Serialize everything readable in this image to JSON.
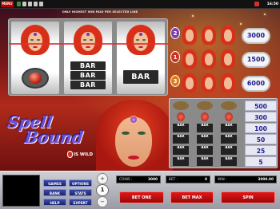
{
  "topbar": {
    "menu_label": "MENU",
    "clock": "16:50",
    "icon_colors": [
      "#3c8c3c",
      "#c8c8c8",
      "#c8c8c8",
      "#c8c8c8",
      "#c8c8c8"
    ]
  },
  "game": {
    "notice": "ONLY HIGHEST WIN PAID PER SELECTED LINE",
    "logo_line1": "Spell",
    "logo_line2": "Bound",
    "wild_label": "IS WILD",
    "reels": [
      {
        "top": "face",
        "middle": "orb"
      },
      {
        "top": "face",
        "middle": "triple-bar"
      },
      {
        "top": "face",
        "middle": "single-bar"
      }
    ],
    "bar_label": "BAR",
    "jackpots": [
      {
        "line": "2",
        "amount": "3000"
      },
      {
        "line": "1",
        "amount": "1500"
      },
      {
        "line": "3",
        "amount": "6000"
      }
    ],
    "paytable": [
      {
        "symbol": "owl",
        "pay": "500"
      },
      {
        "symbol": "orb",
        "pay": "300"
      },
      {
        "symbol": "triple-bar",
        "pay": "100"
      },
      {
        "symbol": "double-bar",
        "pay": "50"
      },
      {
        "symbol": "single-bar",
        "pay": "25"
      },
      {
        "symbol": "any-bar",
        "pay": "5"
      }
    ]
  },
  "console": {
    "games": "GAMES",
    "options": "OPTIONS",
    "bank": "BANK",
    "stats": "STATS",
    "help": "HELP",
    "expert": "EXPERT",
    "coin_value": "1",
    "coin_up": "+",
    "coin_down": "−",
    "coins_label": "COINS :",
    "coins_value": "3000",
    "bet_label": "BET :",
    "bet_value": "0",
    "win_label": "WIN :",
    "win_value": "3000.00",
    "bet_one": "BET ONE",
    "bet_max": "BET MAX",
    "spin": "SPIN"
  }
}
